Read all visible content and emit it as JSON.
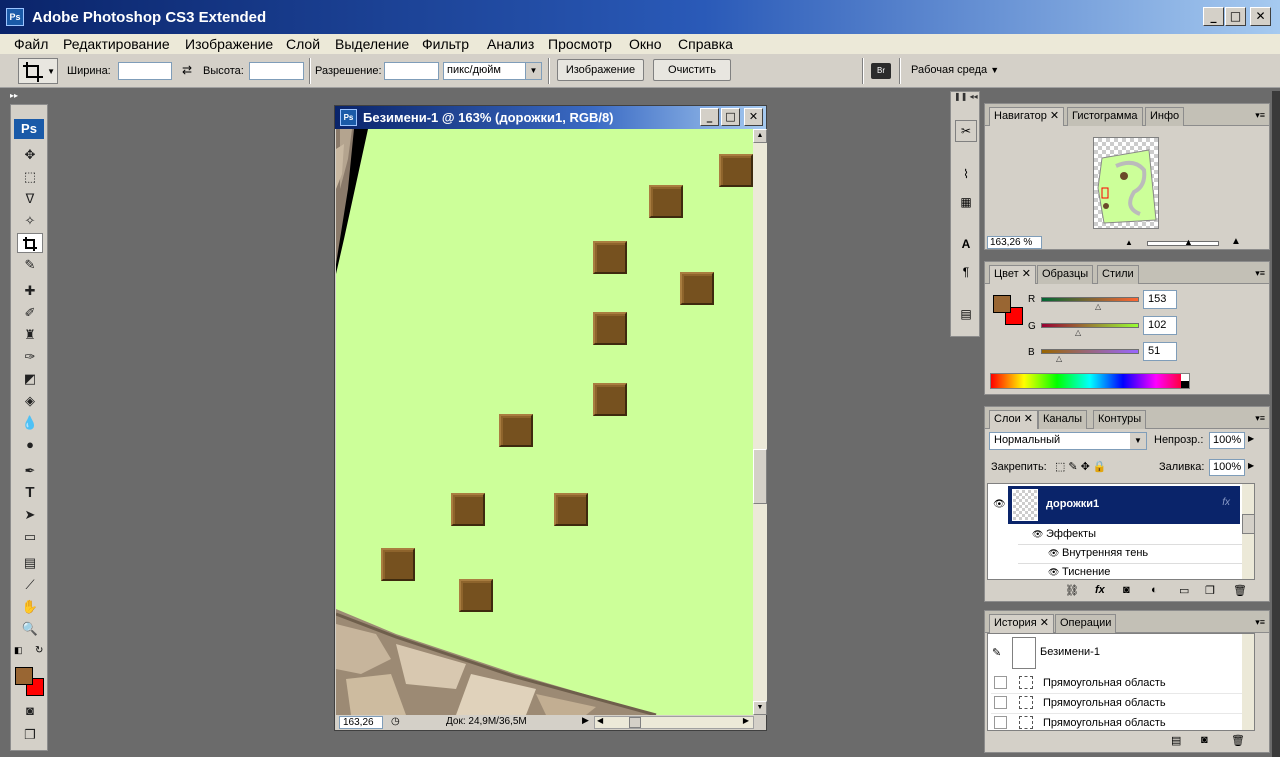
{
  "app": {
    "title": "Adobe Photoshop CS3 Extended",
    "icon_text": "Ps"
  },
  "window_controls": {
    "minimize": "_",
    "maximize": "□",
    "close": "✕"
  },
  "menu": [
    "Файл",
    "Редактирование",
    "Изображение",
    "Слой",
    "Выделение",
    "Фильтр",
    "Анализ",
    "Просмотр",
    "Окно",
    "Справка"
  ],
  "options": {
    "width_label": "Ширина:",
    "height_label": "Высота:",
    "resolution_label": "Разрешение:",
    "units": "пикс/дюйм",
    "image_button": "Изображение",
    "clear_button": "Очистить",
    "workspace": "Рабочая среда"
  },
  "tools": {
    "ps_logo": "Ps",
    "type_tool": "T"
  },
  "colors": {
    "foreground": "#996633",
    "background": "#ff0000",
    "canvas": "#ccff99",
    "block": "#76511f"
  },
  "document": {
    "title": "Безимени-1 @ 163% (дорожки1, RGB/8)",
    "zoom": "163,26 %",
    "doc_info": "Док: 24,9M/36,5M"
  },
  "navigator": {
    "tabs": [
      "Навигатор",
      "Гистограмма",
      "Инфо"
    ],
    "zoom": "163,26 %"
  },
  "color_panel": {
    "tabs": [
      "Цвет",
      "Образцы",
      "Стили"
    ],
    "channels": [
      {
        "label": "R",
        "value": "153"
      },
      {
        "label": "G",
        "value": "102"
      },
      {
        "label": "B",
        "value": "51"
      }
    ]
  },
  "layers": {
    "tabs": [
      "Слои",
      "Каналы",
      "Контуры"
    ],
    "blend_mode": "Нормальный",
    "opacity_label": "Непрозр.:",
    "opacity": "100%",
    "lock_label": "Закрепить:",
    "fill_label": "Заливка:",
    "fill": "100%",
    "layer_name": "дорожки1",
    "effects_label": "Эффекты",
    "effect_items": [
      "Внутренняя тень",
      "Тиснение"
    ]
  },
  "history": {
    "tabs": [
      "История",
      "Операции"
    ],
    "snapshot": "Безимени-1",
    "states": [
      "Прямоугольная область",
      "Прямоугольная область",
      "Прямоугольная область"
    ]
  }
}
